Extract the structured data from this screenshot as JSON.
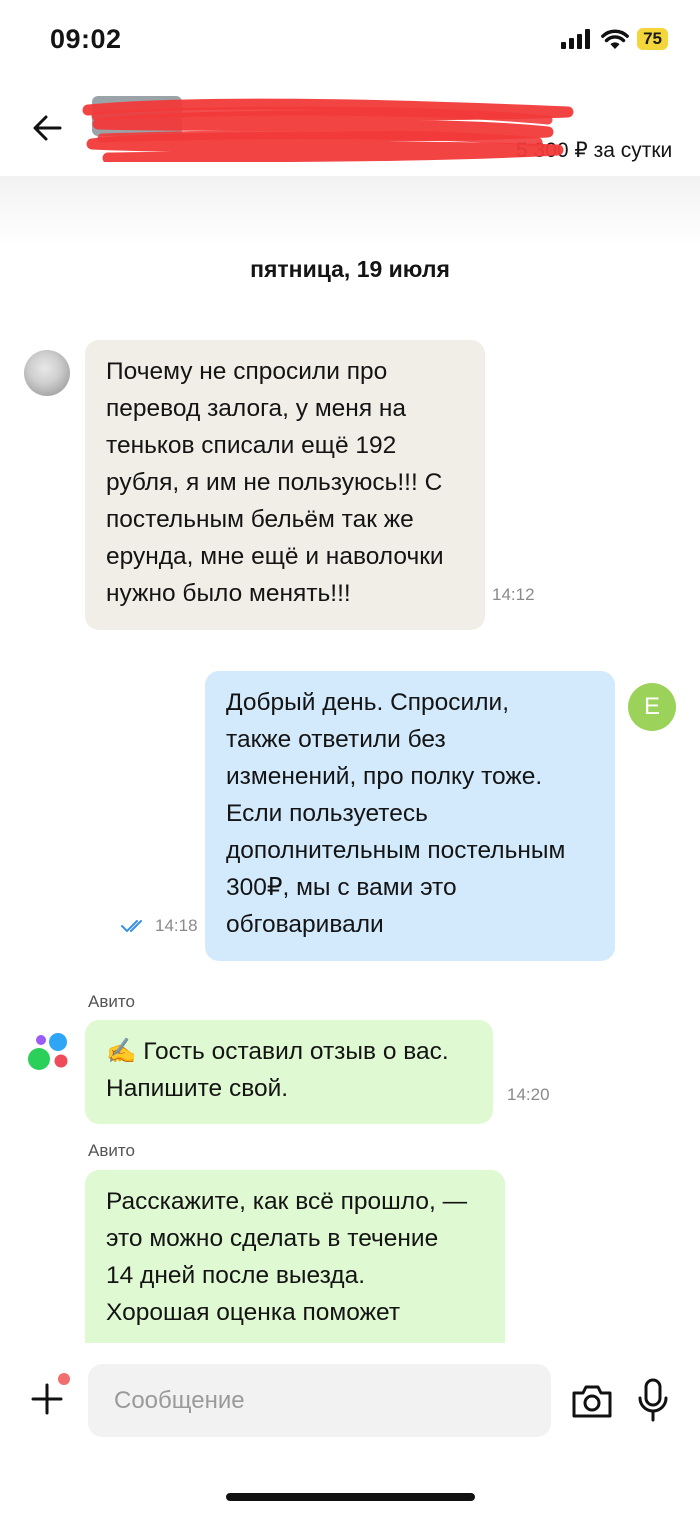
{
  "status_bar": {
    "time": "09:02",
    "battery": "75",
    "icons": [
      "signal-icon",
      "wifi-icon",
      "battery-icon"
    ]
  },
  "header": {
    "price_text": "5 300 ₽ за сутки",
    "back_icon": "arrow-left-icon"
  },
  "chat": {
    "date_separator": "пятница, 19 июля",
    "messages": [
      {
        "direction": "incoming",
        "lines": [
          "Почему не спросили про",
          "перевод залога, у меня на",
          "теньков списали ещё 192",
          "рубля, я им не пользуюсь!!! С",
          "постельным бельём так же",
          "ерунда, мне ещё и наволочки",
          "нужно было менять!!!"
        ],
        "time": "14:12"
      },
      {
        "direction": "outgoing",
        "avatar_letter": "Е",
        "lines": [
          "Добрый день. Спросили,",
          "также ответили без",
          "изменений, про полку тоже.",
          "Если пользуетесь",
          "дополнительным постельным",
          "300₽, мы с вами это",
          "обговаривали"
        ],
        "time": "14:18",
        "status_icon": "double-check-icon"
      },
      {
        "direction": "system",
        "sender": "Авито",
        "lines": [
          "✍️ Гость оставил отзыв о вас.",
          "Напишите свой."
        ],
        "time": "14:20"
      },
      {
        "direction": "system",
        "sender": "Авито",
        "lines": [
          "Расскажите, как всё прошло, —",
          "это можно сделать в течение",
          "14 дней после выезда.",
          "Хорошая оценка поможет"
        ]
      }
    ]
  },
  "composer": {
    "placeholder": "Сообщение",
    "value": "",
    "icons": [
      "plus-icon",
      "camera-icon",
      "microphone-icon"
    ]
  },
  "colors": {
    "incoming_bubble": "#f1eee8",
    "outgoing_bubble": "#d3eafd",
    "system_bubble": "#dff9d3",
    "avatar_e": "#9bd35a",
    "read_check": "#3a8fe8",
    "redaction": "#f23a3a"
  }
}
